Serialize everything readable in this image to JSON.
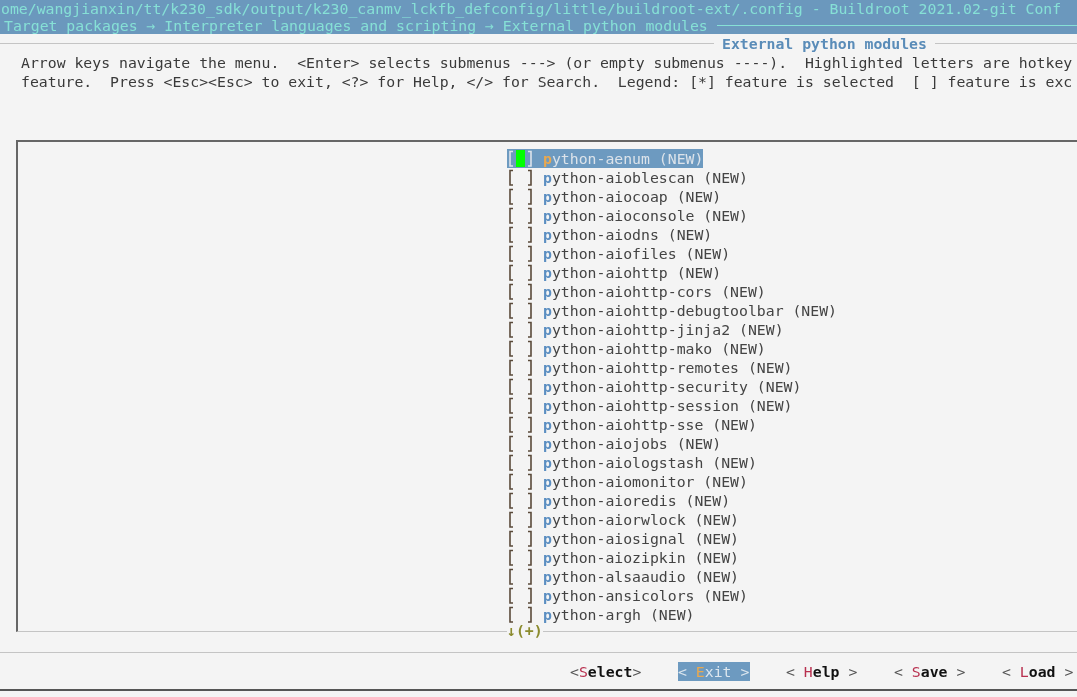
{
  "window": {
    "title": "ome/wangjianxin/tt/k230_sdk/output/k230_canmv_lckfb_defconfig/little/buildroot-ext/.config - Buildroot 2021.02-git Conf",
    "breadcrumb": "Target packages → Interpreter languages and scripting → External python modules"
  },
  "dialog": {
    "title": "External python modules",
    "help": [
      "Arrow keys navigate the menu.  <Enter> selects submenus ---> (or empty submenus ----).  Highlighted letters are hotkey",
      "feature.  Press <Esc><Esc> to exit, <?> for Help, </> for Search.  Legend: [*] feature is selected  [ ] feature is exc"
    ]
  },
  "items": [
    {
      "label": "python-aenum (NEW)",
      "checked": false,
      "selected": true
    },
    {
      "label": "python-aioblescan (NEW)",
      "checked": false,
      "selected": false
    },
    {
      "label": "python-aiocoap (NEW)",
      "checked": false,
      "selected": false
    },
    {
      "label": "python-aioconsole (NEW)",
      "checked": false,
      "selected": false
    },
    {
      "label": "python-aiodns (NEW)",
      "checked": false,
      "selected": false
    },
    {
      "label": "python-aiofiles (NEW)",
      "checked": false,
      "selected": false
    },
    {
      "label": "python-aiohttp (NEW)",
      "checked": false,
      "selected": false
    },
    {
      "label": "python-aiohttp-cors (NEW)",
      "checked": false,
      "selected": false
    },
    {
      "label": "python-aiohttp-debugtoolbar (NEW)",
      "checked": false,
      "selected": false
    },
    {
      "label": "python-aiohttp-jinja2 (NEW)",
      "checked": false,
      "selected": false
    },
    {
      "label": "python-aiohttp-mako (NEW)",
      "checked": false,
      "selected": false
    },
    {
      "label": "python-aiohttp-remotes (NEW)",
      "checked": false,
      "selected": false
    },
    {
      "label": "python-aiohttp-security (NEW)",
      "checked": false,
      "selected": false
    },
    {
      "label": "python-aiohttp-session (NEW)",
      "checked": false,
      "selected": false
    },
    {
      "label": "python-aiohttp-sse (NEW)",
      "checked": false,
      "selected": false
    },
    {
      "label": "python-aiojobs (NEW)",
      "checked": false,
      "selected": false
    },
    {
      "label": "python-aiologstash (NEW)",
      "checked": false,
      "selected": false
    },
    {
      "label": "python-aiomonitor (NEW)",
      "checked": false,
      "selected": false
    },
    {
      "label": "python-aioredis (NEW)",
      "checked": false,
      "selected": false
    },
    {
      "label": "python-aiorwlock (NEW)",
      "checked": false,
      "selected": false
    },
    {
      "label": "python-aiosignal (NEW)",
      "checked": false,
      "selected": false
    },
    {
      "label": "python-aiozipkin (NEW)",
      "checked": false,
      "selected": false
    },
    {
      "label": "python-alsaaudio (NEW)",
      "checked": false,
      "selected": false
    },
    {
      "label": "python-ansicolors (NEW)",
      "checked": false,
      "selected": false
    },
    {
      "label": "python-argh (NEW)",
      "checked": false,
      "selected": false
    }
  ],
  "more_indicator": "↓(+)",
  "buttons": [
    {
      "label": "<Select>",
      "selected": false
    },
    {
      "label": "< Exit >",
      "selected": true
    },
    {
      "label": "< Help >",
      "selected": false
    },
    {
      "label": "< Save >",
      "selected": false
    },
    {
      "label": "< Load >",
      "selected": false
    }
  ]
}
